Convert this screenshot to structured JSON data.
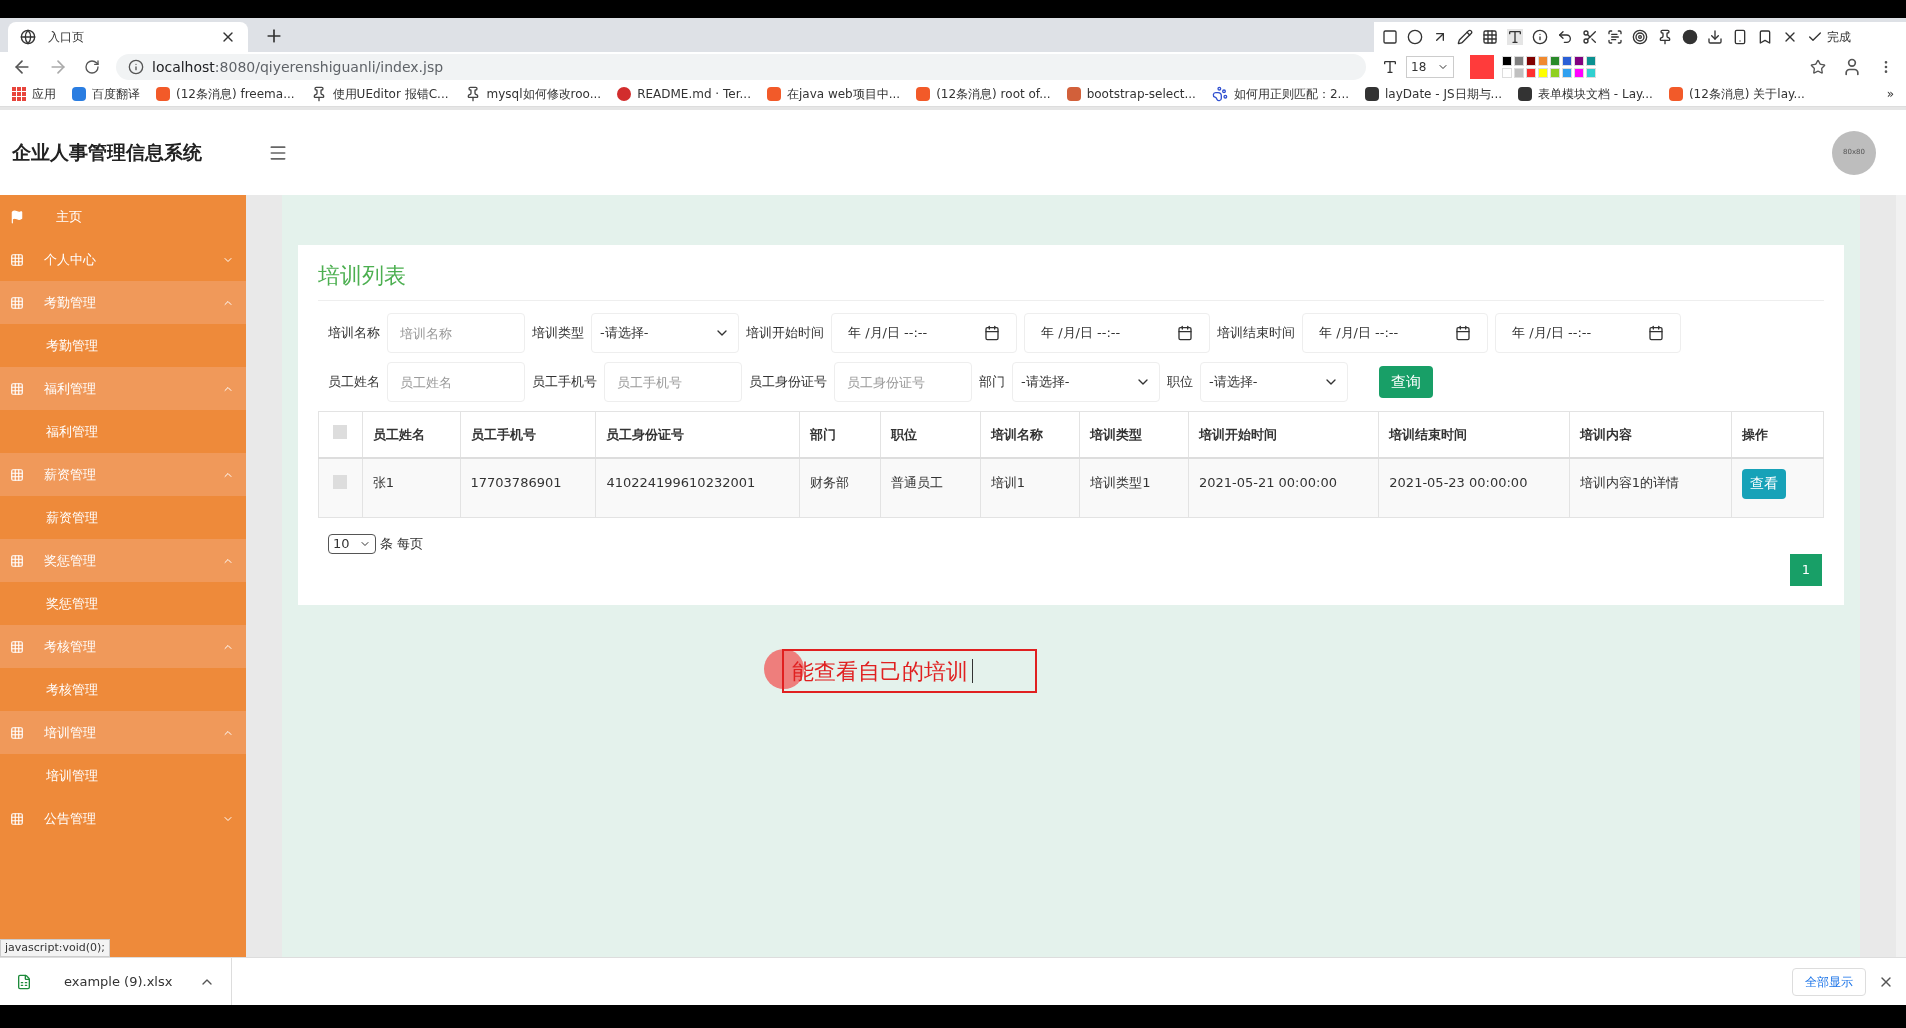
{
  "browser": {
    "tab_title": "入口页",
    "url_host": "localhost",
    "url_rest": ":8080/qiyerenshiguanli/index.jsp",
    "bookmarks": [
      {
        "label": "应用",
        "kind": "grid",
        "color": "#e8453c"
      },
      {
        "label": "百度翻译",
        "kind": "square",
        "color": "#2a7de1"
      },
      {
        "label": "(12条消息) freema...",
        "kind": "square",
        "color": "#f25a29"
      },
      {
        "label": "使用UEditor 报错C...",
        "kind": "glyph",
        "color": "#444444"
      },
      {
        "label": "mysql如何修改roo...",
        "kind": "glyph",
        "color": "#444444"
      },
      {
        "label": "README.md · Ter...",
        "kind": "round",
        "color": "#d22d2d"
      },
      {
        "label": "在java web项目中...",
        "kind": "square",
        "color": "#f25a29"
      },
      {
        "label": "(12条消息) root of...",
        "kind": "square",
        "color": "#f25a29"
      },
      {
        "label": "bootstrap-select...",
        "kind": "square",
        "color": "#d2603a"
      },
      {
        "label": "如何用正则匹配：2...",
        "kind": "paw",
        "color": "#3050d0"
      },
      {
        "label": "layDate - JS日期与...",
        "kind": "square",
        "color": "#333333"
      },
      {
        "label": "表单模块文档 - Lay...",
        "kind": "square",
        "color": "#333333"
      },
      {
        "label": "(12条消息) 关于lay...",
        "kind": "square",
        "color": "#f25a29"
      }
    ],
    "more": "»"
  },
  "capture_toolbar": {
    "font_size": "18",
    "current": {
      "color": "#ff3b3b"
    },
    "done": "完成",
    "swatches": [
      {
        "color": "#000000"
      },
      {
        "color": "#808080"
      },
      {
        "color": "#800000"
      },
      {
        "color": "#f08a30"
      },
      {
        "color": "#2a8a2a"
      },
      {
        "color": "#2b5fd6"
      },
      {
        "color": "#800080"
      },
      {
        "color": "#0a9090"
      },
      {
        "color": "#ffffff"
      },
      {
        "color": "#c0c0c0"
      },
      {
        "color": "#ff3030"
      },
      {
        "color": "#ffff00"
      },
      {
        "color": "#90d020"
      },
      {
        "color": "#30a0f0"
      },
      {
        "color": "#ff00ff"
      },
      {
        "color": "#30d0d0"
      }
    ]
  },
  "app": {
    "title": "企业人事管理信息系统",
    "avatar": "80x80"
  },
  "sidebar": {
    "items": [
      {
        "label": "主页",
        "kind": "flag"
      },
      {
        "label": "个人中心",
        "kind": "group",
        "expanded": false
      },
      {
        "label": "考勤管理",
        "kind": "group",
        "expanded": true,
        "children": [
          {
            "label": "考勤管理"
          }
        ]
      },
      {
        "label": "福利管理",
        "kind": "group",
        "expanded": true,
        "children": [
          {
            "label": "福利管理"
          }
        ]
      },
      {
        "label": "薪资管理",
        "kind": "group",
        "expanded": true,
        "children": [
          {
            "label": "薪资管理"
          }
        ]
      },
      {
        "label": "奖惩管理",
        "kind": "group",
        "expanded": true,
        "children": [
          {
            "label": "奖惩管理"
          }
        ]
      },
      {
        "label": "考核管理",
        "kind": "group",
        "expanded": true,
        "children": [
          {
            "label": "考核管理"
          }
        ]
      },
      {
        "label": "培训管理",
        "kind": "group",
        "expanded": true,
        "children": [
          {
            "label": "培训管理"
          }
        ]
      },
      {
        "label": "公告管理",
        "kind": "group",
        "expanded": false
      }
    ]
  },
  "page_title": "培训列表",
  "filter_rows": [
    [
      {
        "label": "培训名称",
        "kind": "text",
        "placeholder": "培训名称"
      },
      {
        "label": "培训类型",
        "kind": "select",
        "value": "-请选择-"
      },
      {
        "label": "培训开始时间",
        "kind": "date",
        "value": "年 /月/日 --:--"
      },
      {
        "kind": "date",
        "value": "年 /月/日 --:--"
      },
      {
        "label": "培训结束时间",
        "kind": "date",
        "value": "年 /月/日 --:--"
      },
      {
        "kind": "date",
        "value": "年 /月/日 --:--"
      }
    ],
    [
      {
        "label": "员工姓名",
        "kind": "text",
        "placeholder": "员工姓名"
      },
      {
        "label": "员工手机号",
        "kind": "text",
        "placeholder": "员工手机号"
      },
      {
        "label": "员工身份证号",
        "kind": "text",
        "placeholder": "员工身份证号"
      },
      {
        "label": "部门",
        "kind": "select",
        "value": "-请选择-"
      },
      {
        "label": "职位",
        "kind": "select",
        "value": "-请选择-"
      },
      {
        "kind": "button",
        "label": "查询"
      }
    ]
  ],
  "table": {
    "all_checked": false,
    "columns": [
      "员工姓名",
      "员工手机号",
      "员工身份证号",
      "部门",
      "职位",
      "培训名称",
      "培训类型",
      "培训开始时间",
      "培训结束时间",
      "培训内容",
      "操作"
    ],
    "rows": [
      {
        "checked": false,
        "cells": [
          "张1",
          "17703786901",
          "410224199610232001",
          "财务部",
          "普通员工",
          "培训1",
          "培训类型1",
          "2021-05-21 00:00:00",
          "2021-05-23 00:00:00",
          "培训内容1的详情"
        ],
        "action": "查看"
      }
    ]
  },
  "page_size": {
    "value": "10",
    "suffix": "条 每页"
  },
  "pagination": [
    {
      "label": "1",
      "selected": true
    }
  ],
  "annotation": {
    "text": "能查看自己的培训"
  },
  "status_link": "javascript:void(0);",
  "download_bar": {
    "file": "example (9).xlsx",
    "show_all": "全部显示"
  }
}
